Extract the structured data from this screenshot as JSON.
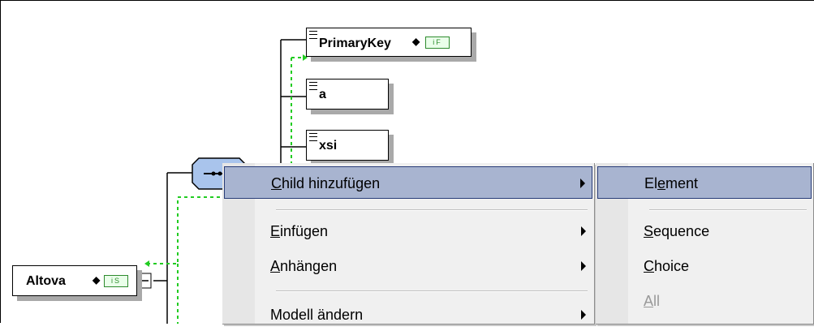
{
  "diagram": {
    "nodes": {
      "primary_key": {
        "label": "PrimaryKey",
        "badge": "iF"
      },
      "a": {
        "label": "a"
      },
      "xsi": {
        "label": "xsi"
      },
      "altova": {
        "label": "Altova",
        "badge": "iS"
      }
    }
  },
  "context_menu": {
    "items": [
      {
        "label": "Child hinzufügen",
        "access_key": "C",
        "rest": "hild hinzufügen",
        "submenu": true,
        "highlighted": true
      },
      {
        "label": "Einfügen",
        "access_key": "E",
        "rest": "infügen",
        "submenu": true
      },
      {
        "label": "Anhängen",
        "access_key": "A",
        "rest": "nhängen",
        "submenu": true
      },
      {
        "label": "Modell ändern",
        "submenu": true
      }
    ]
  },
  "submenu": {
    "items": [
      {
        "label": "Element",
        "pre": "El",
        "access_key": "e",
        "rest": "ment",
        "highlighted": true
      },
      {
        "label": "Sequence",
        "access_key": "S",
        "rest": "equence"
      },
      {
        "label": "Choice",
        "access_key": "C",
        "rest": "hoice"
      },
      {
        "label": "All",
        "access_key": "A",
        "rest": "ll",
        "disabled": true
      }
    ]
  },
  "colors": {
    "menu_highlight": "#a8b4d0",
    "menu_highlight_border": "#283c78",
    "dashed_connector": "#22cc22",
    "sequence_node": "#a9c4ec"
  }
}
